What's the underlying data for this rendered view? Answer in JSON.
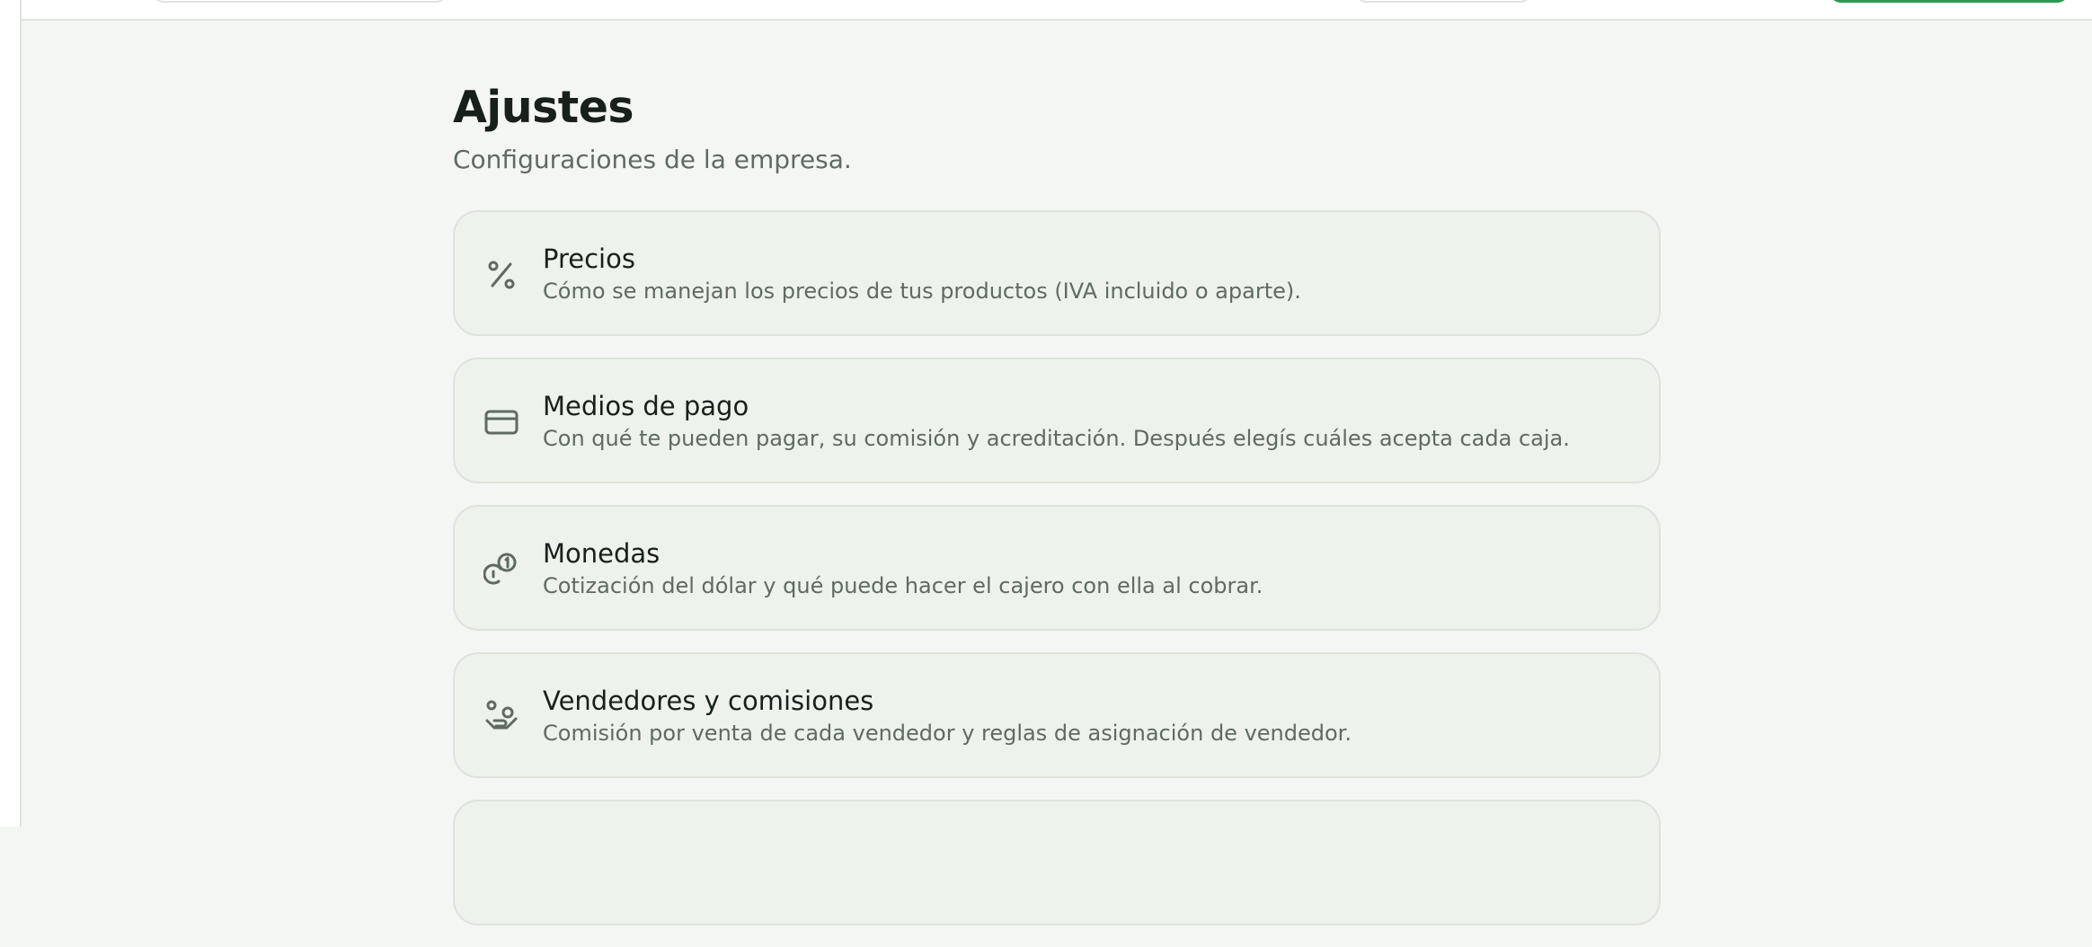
{
  "header": {
    "title": "Ajustes",
    "subtitle": "Configuraciones de la empresa."
  },
  "settings": [
    {
      "icon": "percent-icon",
      "title": "Precios",
      "description": "Cómo se manejan los precios de tus productos (IVA incluido o aparte)."
    },
    {
      "icon": "credit-card-icon",
      "title": "Medios de pago",
      "description": "Con qué te pueden pagar, su comisión y acreditación. Después elegís cuáles acepta cada caja."
    },
    {
      "icon": "coins-icon",
      "title": "Monedas",
      "description": "Cotización del dólar y qué puede hacer el cajero con ella al cobrar."
    },
    {
      "icon": "hand-coins-icon",
      "title": "Vendedores y comisiones",
      "description": "Comisión por venta de cada vendedor y reglas de asignación de vendedor."
    }
  ],
  "colors": {
    "background": "#f4f6f3",
    "card_background": "#edf2ec",
    "card_border": "#dde3db",
    "primary_green": "#2c9a52",
    "icon_color": "#5f6a62"
  }
}
